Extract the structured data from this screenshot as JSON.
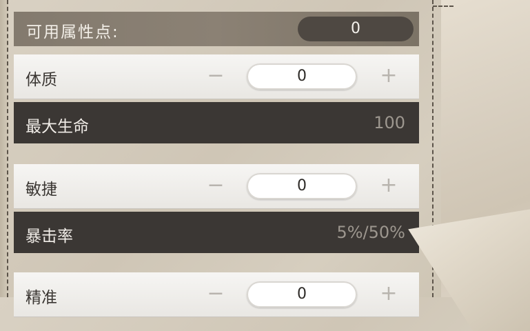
{
  "available_points": {
    "label": "可用属性点:",
    "value": "0"
  },
  "stats": [
    {
      "name": "体质",
      "minus": "−",
      "plus": "+",
      "value": "0",
      "derived": {
        "name": "最大生命",
        "value": "100"
      }
    },
    {
      "name": "敏捷",
      "minus": "−",
      "plus": "+",
      "value": "0",
      "derived": {
        "name": "暴击率",
        "value": "5%/50%"
      }
    },
    {
      "name": "精准",
      "minus": "−",
      "plus": "+",
      "value": "0"
    }
  ],
  "colors": {
    "points_bar": "#8b8174",
    "stat_row": "#f6f5f3",
    "derived_row": "#3b3734"
  }
}
